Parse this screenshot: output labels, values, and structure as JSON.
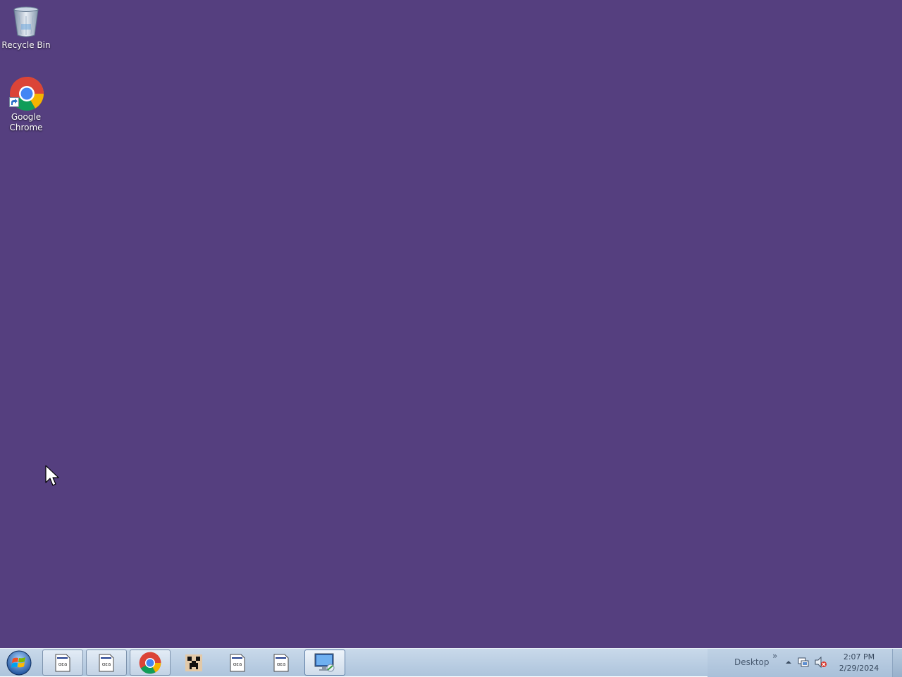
{
  "desktop": {
    "background_color": "#553f7f",
    "icons": [
      {
        "label": "Recycle Bin",
        "icon": "recycle-bin-icon"
      },
      {
        "label": "Google Chrome",
        "icon": "chrome-icon"
      }
    ]
  },
  "taskbar": {
    "start_icon": "windows-start-orb-icon",
    "buttons": [
      {
        "icon": "java-app-icon",
        "style": "framed"
      },
      {
        "icon": "java-app-icon",
        "style": "framed"
      },
      {
        "icon": "chrome-icon",
        "style": "framed"
      },
      {
        "icon": "minecraft-icon",
        "style": "plain"
      },
      {
        "icon": "java-app-icon",
        "style": "plain"
      },
      {
        "icon": "java-app-icon",
        "style": "plain"
      },
      {
        "icon": "remote-desktop-icon",
        "style": "active"
      }
    ],
    "toolbar_label": "Desktop",
    "toolbar_chevron": "»",
    "tray_icons": [
      "show-hidden-icons-icon",
      "network-icon",
      "volume-muted-icon"
    ],
    "clock": {
      "time": "2:07 PM",
      "date": "2/29/2024"
    }
  }
}
